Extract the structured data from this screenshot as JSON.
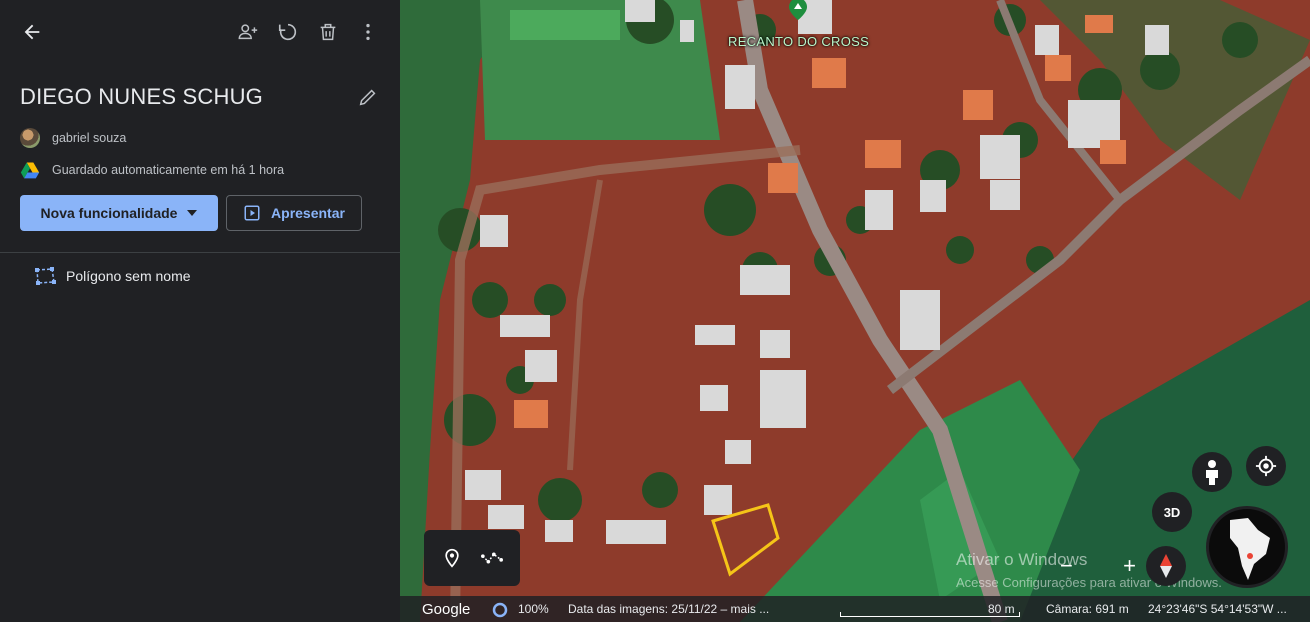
{
  "sidebar": {
    "project_title": "DIEGO NUNES SCHUG",
    "owner_name": "gabriel souza",
    "save_status": "Guardado automaticamente em há 1 hora",
    "new_feature_label": "Nova funcionalidade",
    "present_label": "Apresentar",
    "items": [
      {
        "label": "Polígono sem nome"
      }
    ],
    "icons": {
      "back": "arrow-left-icon",
      "share": "person-add-icon",
      "history": "history-icon",
      "delete": "trash-icon",
      "more": "more-vert-icon",
      "edit": "pencil-icon",
      "drive": "google-drive-icon",
      "polygon": "polygon-icon"
    }
  },
  "map": {
    "place_label": "RECANTO DO CROSS",
    "three_d_label": "3D",
    "watermark_title": "Ativar o Windows",
    "watermark_subtitle": "Acesse Configurações para ativar o Windows.",
    "statusbar": {
      "brand": "Google",
      "zoom": "100%",
      "imagery_date": "Data das imagens: 25/11/22 – mais ...",
      "scale": "80 m",
      "camera": "Câmara: 691 m",
      "coordinates": "24°23'46\"S 54°14'53\"W ..."
    },
    "colors": {
      "accent": "#8ab4f8",
      "polygon_stroke": "#f5c518",
      "panel": "#202124"
    }
  }
}
